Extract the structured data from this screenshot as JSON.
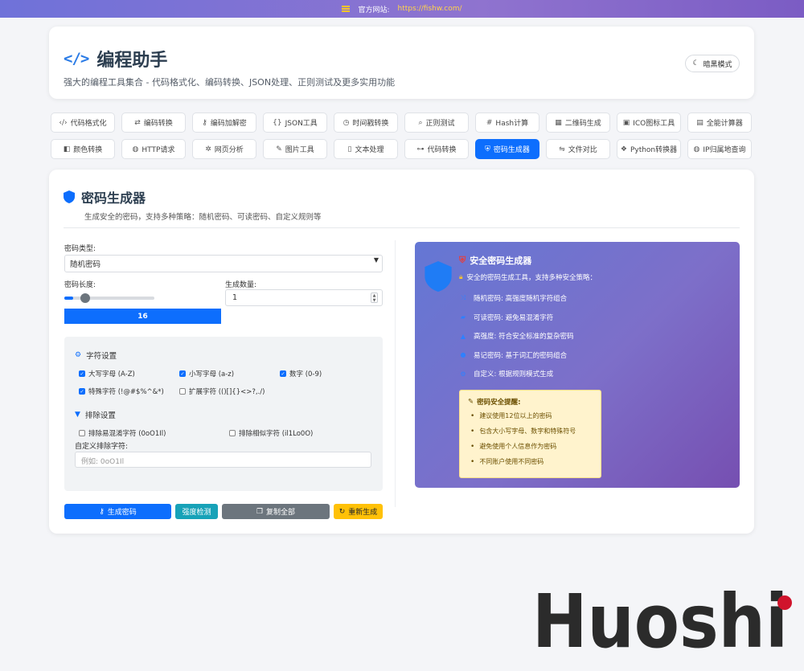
{
  "topbar": {
    "label": "官方网站:",
    "link": "https://fishw.com/"
  },
  "header": {
    "title": "编程助手",
    "subtitle": "强大的编程工具集合 - 代码格式化、编码转换、JSON处理、正则测试及更多实用功能",
    "theme_button": "暗黑模式"
  },
  "tools": [
    {
      "label": "代码格式化",
      "icon": "code-icon"
    },
    {
      "label": "编码转换",
      "icon": "exchange-icon"
    },
    {
      "label": "编码加解密",
      "icon": "key-icon"
    },
    {
      "label": "JSON工具",
      "icon": "braces-icon"
    },
    {
      "label": "时间戳转换",
      "icon": "clock-icon"
    },
    {
      "label": "正则测试",
      "icon": "search-icon"
    },
    {
      "label": "Hash计算",
      "icon": "hash-icon"
    },
    {
      "label": "二维码生成",
      "icon": "qrcode-icon"
    },
    {
      "label": "ICO图标工具",
      "icon": "image-icon"
    },
    {
      "label": "全能计算器",
      "icon": "calculator-icon"
    },
    {
      "label": "颜色转换",
      "icon": "palette-icon"
    },
    {
      "label": "HTTP请求",
      "icon": "globe-icon"
    },
    {
      "label": "网页分析",
      "icon": "bug-icon"
    },
    {
      "label": "图片工具",
      "icon": "pen-icon"
    },
    {
      "label": "文本处理",
      "icon": "file-icon"
    },
    {
      "label": "代码转换",
      "icon": "sitemap-icon"
    },
    {
      "label": "密码生成器",
      "icon": "shield-icon",
      "active": true
    },
    {
      "label": "文件对比",
      "icon": "diff-icon"
    },
    {
      "label": "Python转换器",
      "icon": "python-icon"
    },
    {
      "label": "IP归属地查询",
      "icon": "globe-icon"
    }
  ],
  "generator": {
    "title": "密码生成器",
    "subtitle": "生成安全的密码，支持多种策略：随机密码、可读密码、自定义规则等",
    "type_label": "密码类型:",
    "type_value": "随机密码",
    "length_label": "密码长度:",
    "length_value": "16",
    "length_min": 4,
    "length_max": 128,
    "count_label": "生成数量:",
    "count_value": "1",
    "charset_head": "字符设置",
    "charset": [
      {
        "label": "大写字母 (A-Z)",
        "checked": true
      },
      {
        "label": "小写字母 (a-z)",
        "checked": true
      },
      {
        "label": "数字 (0-9)",
        "checked": true
      },
      {
        "label": "特殊字符 (!@#$%^&*)",
        "checked": true
      },
      {
        "label": "扩展字符 (()[]{}<>?,./)",
        "checked": false
      }
    ],
    "exclude_head": "排除设置",
    "exclude": [
      {
        "label": "排除易混淆字符 (0oO1Il)",
        "checked": false
      },
      {
        "label": "排除相似字符 (il1Lo0O)",
        "checked": false
      }
    ],
    "custom_label": "自定义排除字符:",
    "custom_placeholder": "例如: 0oO1Il",
    "buttons": {
      "generate": "生成密码",
      "check": "强度检测",
      "copy_all": "复制全部",
      "regenerate": "重新生成"
    }
  },
  "info": {
    "title": "安全密码生成器",
    "desc": "安全的密码生成工具，支持多种安全策略：",
    "features": [
      {
        "icon": "shuffle-icon",
        "text": "随机密码: 高强度随机字符组合"
      },
      {
        "icon": "book-icon",
        "text": "可读密码: 避免易混淆字符"
      },
      {
        "icon": "lock-icon",
        "text": "高强度: 符合安全标准的复杂密码"
      },
      {
        "icon": "brain-icon",
        "text": "易记密码: 基于词汇的密码组合"
      },
      {
        "icon": "sliders-icon",
        "text": "自定义: 根据规则模式生成"
      }
    ],
    "tips_title": "密码安全提醒:",
    "tips": [
      "建议使用12位以上的密码",
      "包含大小写字母、数字和特殊符号",
      "避免使用个人信息作为密码",
      "不同账户使用不同密码"
    ]
  },
  "colors": {
    "primary": "#0d6efd",
    "info": "#17a2b8",
    "secondary": "#6c757d",
    "warning": "#ffc107",
    "brand_dot": "#d0142c"
  },
  "watermark": "Huoshi"
}
